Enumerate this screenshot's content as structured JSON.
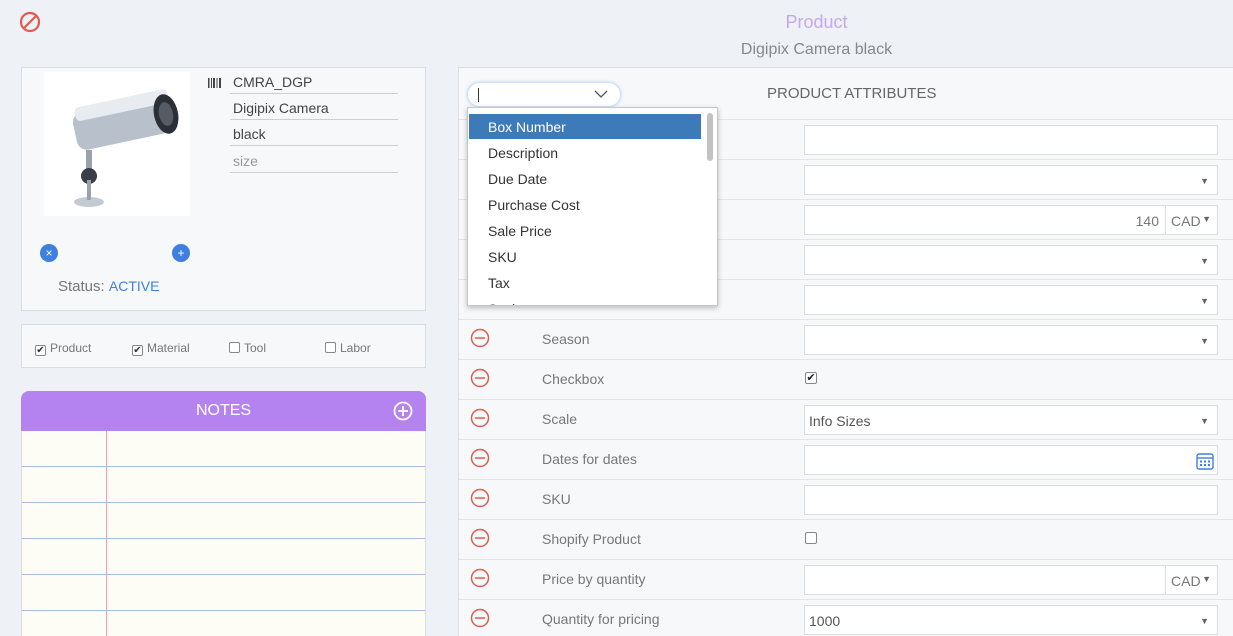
{
  "header": {
    "title": "Product",
    "subtitle": "Digipix Camera black"
  },
  "product": {
    "sku": "CMRA_DGP",
    "name": "Digipix Camera",
    "color": "black",
    "size_placeholder": "size",
    "status_label": "Status:",
    "status_value": "ACTIVE"
  },
  "types": [
    {
      "label": "Product",
      "checked": true
    },
    {
      "label": "Material",
      "checked": true
    },
    {
      "label": "Tool",
      "checked": false
    },
    {
      "label": "Labor",
      "checked": false
    }
  ],
  "notes": {
    "title": "NOTES"
  },
  "attributes": {
    "title": "PRODUCT ATTRIBUTES",
    "dropdown_options": [
      "Box Number",
      "Description",
      "Due Date",
      "Purchase Cost",
      "Sale Price",
      "SKU",
      "Tax",
      "Scale"
    ],
    "dropdown_selected": "Box Number",
    "price_value": "140",
    "currency": "CAD",
    "rows": [
      {
        "label": "Season",
        "value": ""
      },
      {
        "label": "Checkbox",
        "checked": true
      },
      {
        "label": "Scale",
        "value": "Info Sizes"
      },
      {
        "label": "Dates for dates",
        "value": ""
      },
      {
        "label": "SKU",
        "value": ""
      },
      {
        "label": "Shopify Product",
        "checked": false
      },
      {
        "label": "Price by quantity",
        "value": "",
        "currency": "CAD"
      },
      {
        "label": "Quantity for pricing",
        "value": "1000"
      }
    ]
  },
  "colors": {
    "accent": "#3f7fe0",
    "notes_header": "#b583f0",
    "title": "#c9a6f0",
    "remove": "#e05a4f"
  }
}
